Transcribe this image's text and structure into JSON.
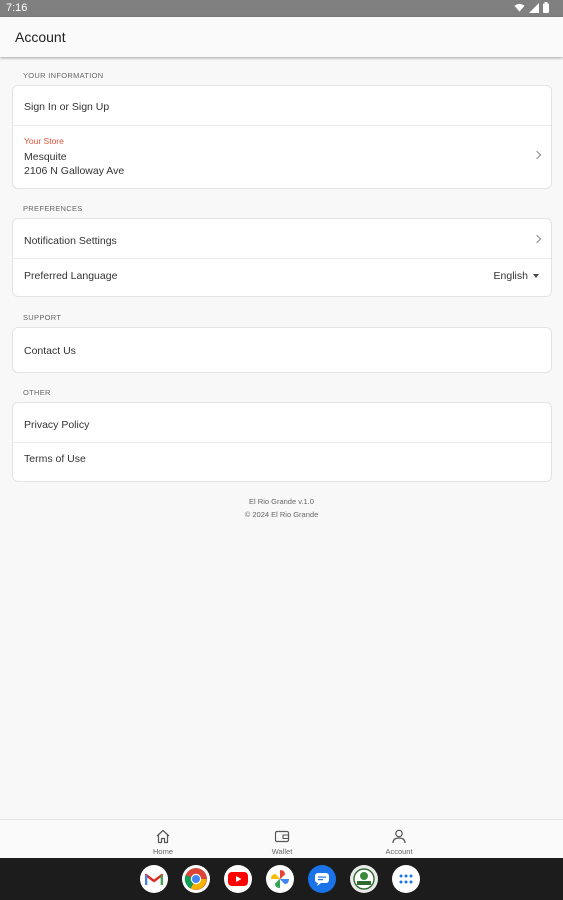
{
  "status_bar": {
    "time": "7:16"
  },
  "app_bar": {
    "title": "Account"
  },
  "sections": {
    "your_information": "YOUR INFORMATION",
    "preferences": "PREFERENCES",
    "support": "SUPPORT",
    "other": "OTHER"
  },
  "your_information": {
    "sign_in": "Sign In or Sign Up",
    "store_label": "Your Store",
    "store_name": "Mesquite",
    "store_address": "2106 N Galloway Ave"
  },
  "preferences": {
    "notifications": "Notification Settings",
    "language_label": "Preferred Language",
    "language_value": "English"
  },
  "support": {
    "contact": "Contact Us"
  },
  "other": {
    "privacy": "Privacy Policy",
    "terms": "Terms of Use"
  },
  "footer": {
    "version": "El Rio Grande v.1.0",
    "copyright": "© 2024 El Rio Grande"
  },
  "bottom_nav": [
    {
      "label": "Home",
      "icon": "home-icon"
    },
    {
      "label": "Wallet",
      "icon": "wallet-icon"
    },
    {
      "label": "Account",
      "icon": "person-icon"
    }
  ],
  "dock_apps": [
    "gmail-icon",
    "chrome-icon",
    "youtube-icon",
    "photos-icon",
    "messages-icon",
    "el-rio-grande-app-icon",
    "app-drawer-icon"
  ],
  "colors": {
    "accent_store_label": "#e0533a",
    "status_bar": "#808080",
    "taskbar": "#1c1c1c"
  }
}
